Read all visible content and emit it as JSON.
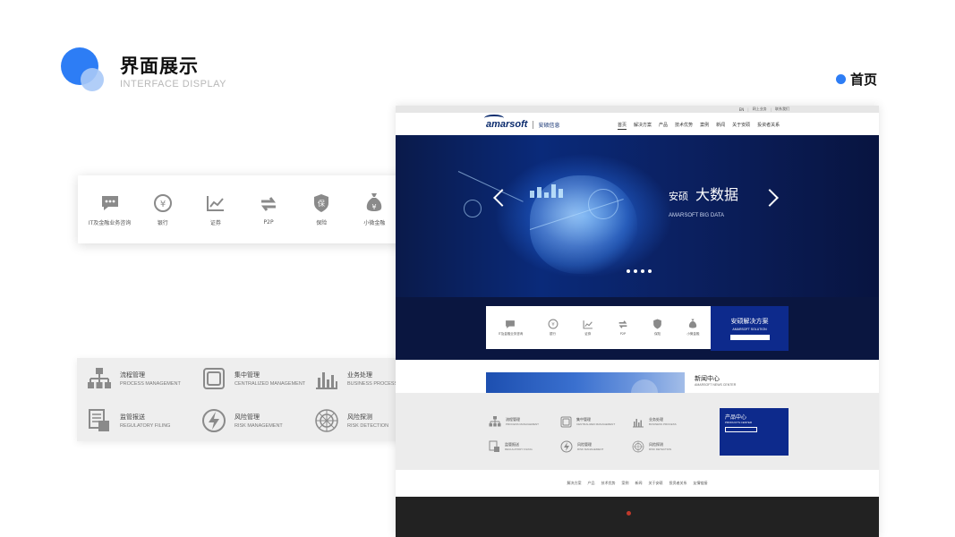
{
  "slide": {
    "title": "界面展示",
    "subtitle": "INTERFACE DISPLAY",
    "page_label": "首页",
    "accent_color": "#2d7df5"
  },
  "card1": {
    "items": [
      {
        "label": "IT及金融业务咨询",
        "icon": "chat-icon"
      },
      {
        "label": "银行",
        "icon": "yen-coin-icon"
      },
      {
        "label": "证券",
        "icon": "line-chart-icon"
      },
      {
        "label": "P2P",
        "icon": "exchange-icon"
      },
      {
        "label": "保险",
        "icon": "shield-icon"
      },
      {
        "label": "小微金融",
        "icon": "money-bag-icon"
      }
    ]
  },
  "card2": {
    "items": [
      {
        "cn": "流程管理",
        "en": "PROCESS MANAGEMENT",
        "icon": "flowchart-icon"
      },
      {
        "cn": "集中管理",
        "en": "CENTRALIZED MANAGEMENT",
        "icon": "square-frame-icon"
      },
      {
        "cn": "业务处理",
        "en": "BUSINESS PROCESS",
        "icon": "bar-chart-icon"
      },
      {
        "cn": "监管报送",
        "en": "REGULATORY FILING",
        "icon": "document-icon"
      },
      {
        "cn": "风险管理",
        "en": "RISK MANAGEMENT",
        "icon": "lightning-icon"
      },
      {
        "cn": "风险探测",
        "en": "RISK DETECTION",
        "icon": "radar-icon"
      }
    ]
  },
  "site": {
    "topbar": {
      "lang": "EN",
      "login": "网上业务",
      "contact": "联系我们"
    },
    "logo": {
      "text": "amarsoft",
      "cn": "安硕信息"
    },
    "nav": [
      "首页",
      "解决方案",
      "产品",
      "技术优势",
      "案例",
      "新闻",
      "关于安硕",
      "投资者关系"
    ],
    "hero": {
      "title_small": "安硕",
      "title_big": "大数据",
      "desc": "",
      "en": "AMARSOFT BIG DATA"
    },
    "services": [
      {
        "label": "IT及金融业务咨询",
        "icon": "chat-icon"
      },
      {
        "label": "银行",
        "icon": "yen-coin-icon"
      },
      {
        "label": "证券",
        "icon": "line-chart-icon"
      },
      {
        "label": "P2P",
        "icon": "exchange-icon"
      },
      {
        "label": "保险",
        "icon": "shield-icon"
      },
      {
        "label": "小微金融",
        "icon": "money-bag-icon"
      }
    ],
    "solution": {
      "cn": "安硕解决方案",
      "en": "AMARSOFT SOLUTION",
      "button": ""
    },
    "news": {
      "title": "新闻中心",
      "en": "AMARSOFT NEWS CENTER",
      "desc": "",
      "button": ""
    },
    "products": [
      {
        "cn": "流程管理",
        "en": "PROCESS MANAGEMENT",
        "icon": "flowchart-icon"
      },
      {
        "cn": "集中管理",
        "en": "CENTRALIZED MANAGEMENT",
        "icon": "square-frame-icon"
      },
      {
        "cn": "业务处理",
        "en": "BUSINESS PROCESS",
        "icon": "bar-chart-icon"
      },
      {
        "cn": "监管报送",
        "en": "REGULATORY FILING",
        "icon": "document-icon"
      },
      {
        "cn": "风险管理",
        "en": "RISK MANAGEMENT",
        "icon": "lightning-icon"
      },
      {
        "cn": "风险探测",
        "en": "RISK DETECTION",
        "icon": "radar-icon"
      }
    ],
    "product_center": {
      "cn": "产品中心",
      "en": "PRODUCTS CENTER",
      "desc": "",
      "button": ""
    },
    "footer_nav": [
      "解决方案",
      "产品",
      "技术优势",
      "案例",
      "新闻",
      "关于安硕",
      "投资者关系",
      "友情链接"
    ],
    "footer": {
      "copyright": "",
      "icp1": "",
      "icp2": ""
    }
  }
}
